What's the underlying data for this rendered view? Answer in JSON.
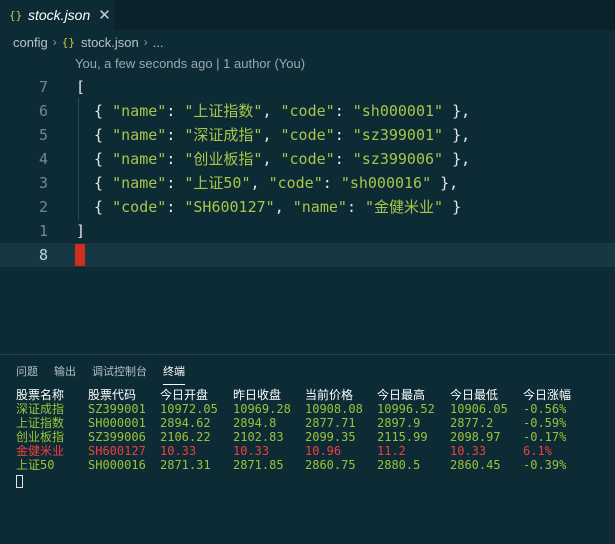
{
  "tab": {
    "icon": "{}",
    "filename": "stock.json",
    "close": "✕"
  },
  "breadcrumb": {
    "folder": "config",
    "file": "stock.json",
    "more": "..."
  },
  "blame": "You, a few seconds ago | 1 author (You)",
  "editor": {
    "lines": [
      {
        "num": "7",
        "text": "["
      },
      {
        "num": "6",
        "k1": "\"name\"",
        "v1": "\"上证指数\"",
        "k2": "\"code\"",
        "v2": "\"sh000001\"",
        "end": " },"
      },
      {
        "num": "5",
        "k1": "\"name\"",
        "v1": "\"深证成指\"",
        "k2": "\"code\"",
        "v2": "\"sz399001\"",
        "end": " },"
      },
      {
        "num": "4",
        "k1": "\"name\"",
        "v1": "\"创业板指\"",
        "k2": "\"code\"",
        "v2": "\"sz399006\"",
        "end": " },"
      },
      {
        "num": "3",
        "k1": "\"name\"",
        "v1": "\"上证50\"",
        "k2": "\"code\"",
        "v2": "\"sh000016\"",
        "end": " },"
      },
      {
        "num": "2",
        "k1": "\"code\"",
        "v1": "\"SH600127\"",
        "k2": "\"name\"",
        "v2": "\"金健米业\"",
        "end": " }"
      },
      {
        "num": "1",
        "text": "]"
      },
      {
        "num": "8",
        "text": ""
      }
    ]
  },
  "panel": {
    "tabs": [
      "问题",
      "输出",
      "调试控制台",
      "终端"
    ],
    "active_tab": "终端"
  },
  "terminal": {
    "headers": [
      "股票名称",
      "股票代码",
      "今日开盘",
      "昨日收盘",
      "当前价格",
      "今日最高",
      "今日最低",
      "今日涨幅"
    ],
    "rows": [
      [
        "深证成指",
        "SZ399001",
        "10972.05",
        "10969.28",
        "10908.08",
        "10996.52",
        "10906.05",
        "-0.56%"
      ],
      [
        "上证指数",
        "SH000001",
        "2894.62",
        "2894.8",
        "2877.71",
        "2897.9",
        "2877.2",
        "-0.59%"
      ],
      [
        "创业板指",
        "SZ399006",
        "2106.22",
        "2102.83",
        "2099.35",
        "2115.99",
        "2098.97",
        "-0.17%"
      ],
      [
        "金健米业",
        "SH600127",
        "10.33",
        "10.33",
        "10.96",
        "11.2",
        "10.33",
        "6.1%"
      ],
      [
        "上证50",
        "SH000016",
        "2871.31",
        "2871.85",
        "2860.75",
        "2880.5",
        "2860.45",
        "-0.39%"
      ]
    ],
    "row_colors": [
      "#9bc33a",
      "#9bc33a",
      "#9bc33a",
      "#f03e3e",
      "#9bc33a"
    ]
  },
  "colors": {
    "background": "#0d2b35",
    "string": "#a7c64a",
    "up": "#f03e3e",
    "down": "#9bc33a",
    "cursor": "#d02d21"
  }
}
